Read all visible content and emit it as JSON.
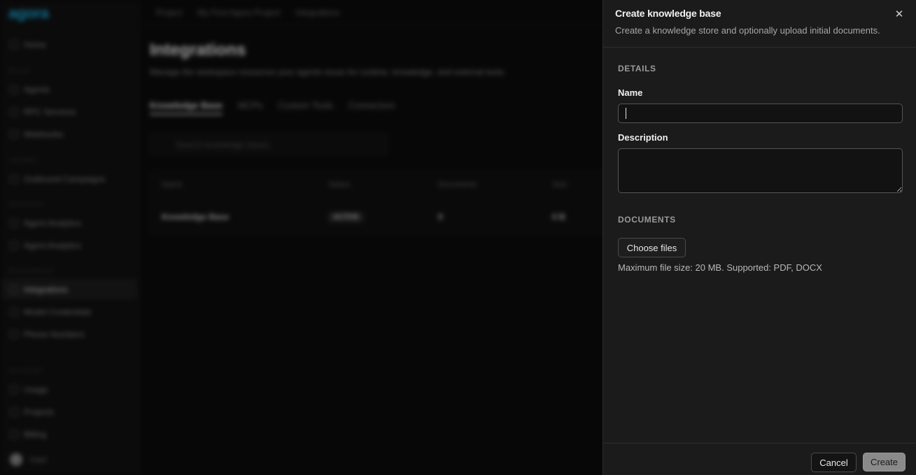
{
  "background": {
    "logo": "agora",
    "sidebar": {
      "items": [
        {
          "label": "Home",
          "section": ""
        },
        {
          "label": "Agents",
          "section": "BUILD"
        },
        {
          "label": "RPC Services",
          "section": ""
        },
        {
          "label": "Webhooks",
          "section": ""
        },
        {
          "label": "Outbound Campaigns",
          "section": "LAUNCH"
        },
        {
          "label": "Agent Analytics",
          "section": "INSIGHTS"
        },
        {
          "label": "Agent Analytics",
          "section": ""
        },
        {
          "label": "Integrations",
          "section": "RESOURCES"
        },
        {
          "label": "Model Credentials",
          "section": ""
        },
        {
          "label": "Phone Numbers",
          "section": ""
        },
        {
          "label": "Usage",
          "section": "ACCOUNT"
        },
        {
          "label": "Projects",
          "section": ""
        },
        {
          "label": "Billing",
          "section": ""
        }
      ],
      "sections": [
        "BUILD",
        "LAUNCH",
        "INSIGHTS",
        "RESOURCES",
        "ACCOUNT"
      ],
      "user_name": "User"
    },
    "breadcrumb": [
      "Project",
      "My First Agora Project",
      "Integrations"
    ],
    "page_title": "Integrations",
    "page_subtitle": "Manage the workspace resources your agents reuse for runtime, knowledge, and external tools.",
    "tabs": [
      "Knowledge Base",
      "MCPs",
      "Custom Tools",
      "Connectors"
    ],
    "search_placeholder": "Search knowledge bases",
    "table": {
      "headers": [
        "Name",
        "Status",
        "Documents",
        "Size"
      ],
      "rows": [
        [
          "Knowledge Base",
          "ACTIVE",
          "0",
          "0 B"
        ]
      ]
    }
  },
  "drawer": {
    "title": "Create knowledge base",
    "subtitle": "Create a knowledge store and optionally upload initial documents.",
    "close_icon": "close-icon",
    "details_section": "DETAILS",
    "name_label": "Name",
    "name_value": "",
    "description_label": "Description",
    "description_value": "",
    "documents_section": "DOCUMENTS",
    "choose_files_label": "Choose files",
    "file_hint": "Maximum file size: 20 MB. Supported: PDF, DOCX",
    "cancel_label": "Cancel",
    "create_label": "Create"
  }
}
